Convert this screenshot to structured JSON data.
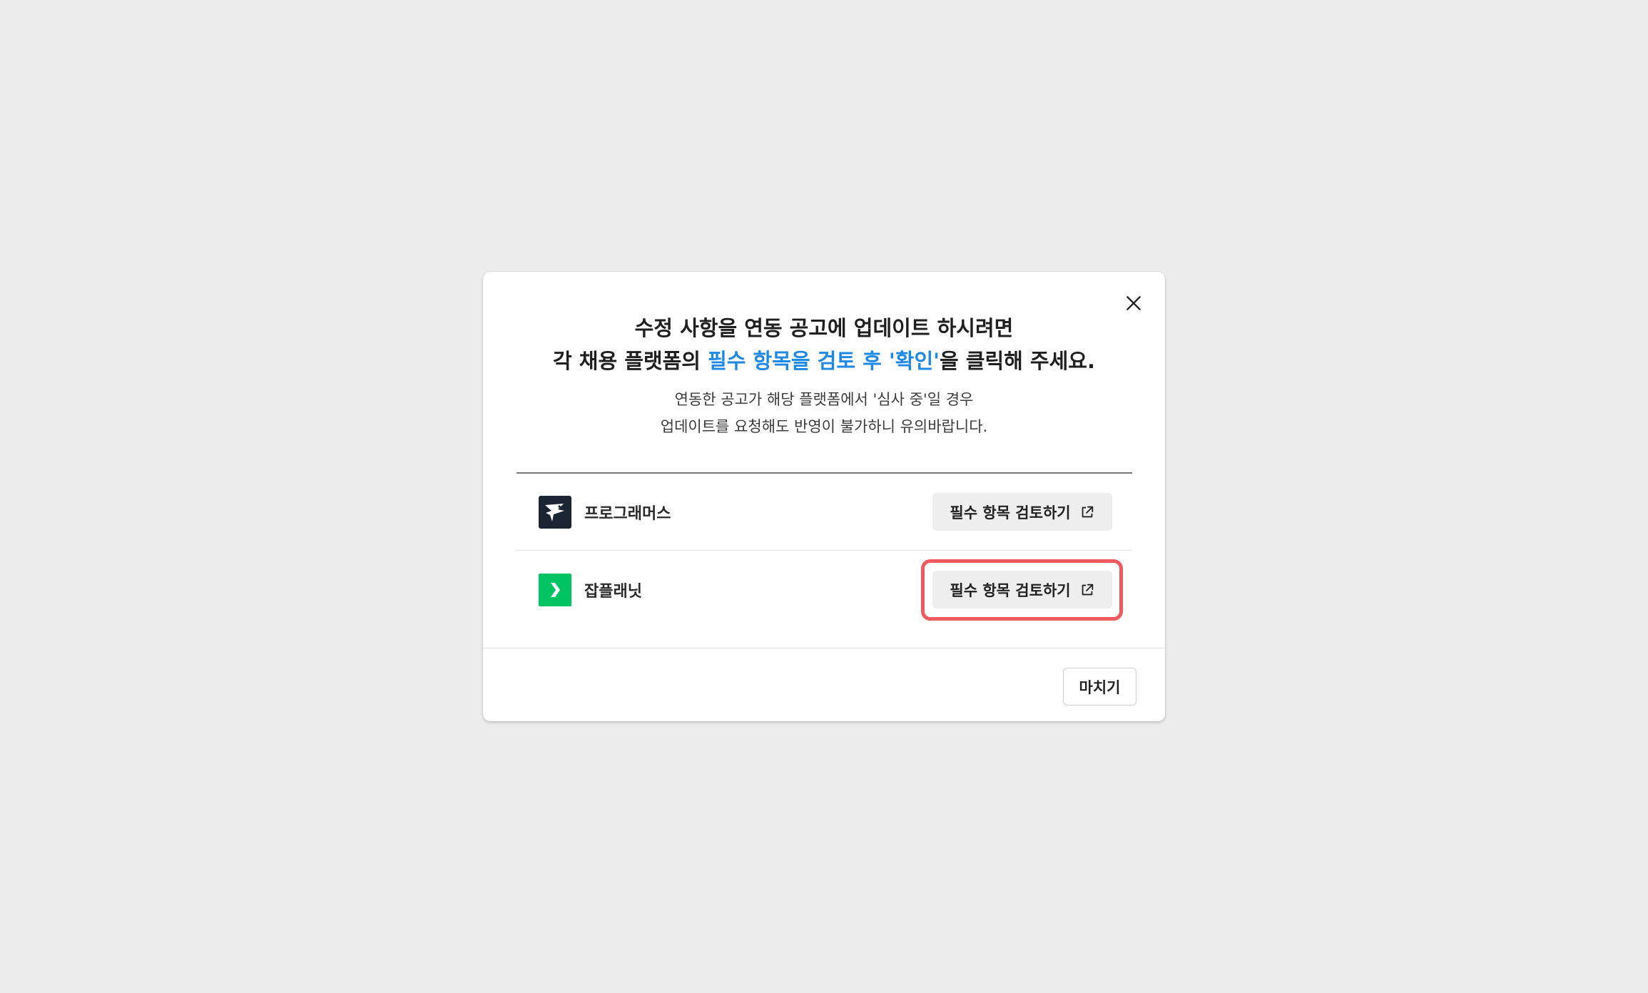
{
  "modal": {
    "title_line1": "수정 사항을 연동 공고에 업데이트 하시려면",
    "title_line2_prefix": "각 채용 플랫폼의 ",
    "title_line2_accent": "필수 항목을 검토 후 '확인'",
    "title_line2_suffix": "을 클릭해 주세요.",
    "subtitle_line1": "연동한 공고가 해당 플랫폼에서 '심사 중'일 경우",
    "subtitle_line2": "업데이트를 요청해도 반영이 불가하니 유의바랍니다.",
    "accent_color": "#1e88e5",
    "close_icon": "close-icon"
  },
  "platforms": [
    {
      "name": "프로그래머스",
      "logo": "programmers-logo",
      "logo_color": "#1b2432",
      "button_label": "필수 항목 검토하기",
      "button_icon": "external-link-icon"
    },
    {
      "name": "잡플래닛",
      "logo": "jobplanet-logo",
      "logo_color": "#00c362",
      "button_label": "필수 항목 검토하기",
      "button_icon": "external-link-icon"
    }
  ],
  "highlight_color": "#ef5a5f",
  "footer": {
    "close_label": "마치기"
  }
}
